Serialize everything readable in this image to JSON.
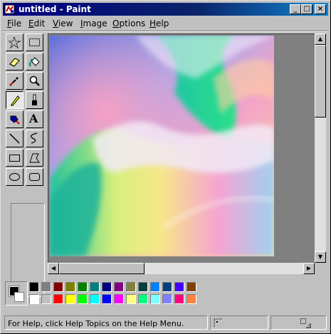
{
  "window": {
    "title": "untitled - Paint",
    "controls": {
      "minimize": "_",
      "maximize": "□",
      "close": "×"
    }
  },
  "menu": [
    {
      "underline": "F",
      "rest": "ile"
    },
    {
      "underline": "E",
      "rest": "dit"
    },
    {
      "underline": "V",
      "rest": "iew"
    },
    {
      "underline": "I",
      "rest": "mage"
    },
    {
      "underline": "O",
      "rest": "ptions"
    },
    {
      "underline": "H",
      "rest": "elp"
    }
  ],
  "tools": [
    {
      "name": "free-form-select",
      "icon": "star-select-icon"
    },
    {
      "name": "rect-select",
      "icon": "dotted-rect-icon"
    },
    {
      "name": "eraser",
      "icon": "eraser-icon"
    },
    {
      "name": "fill",
      "icon": "paint-bucket-icon"
    },
    {
      "name": "pick-color",
      "icon": "eyedropper-icon"
    },
    {
      "name": "magnifier",
      "icon": "magnifier-icon"
    },
    {
      "name": "pencil",
      "icon": "pencil-icon",
      "pressed": true
    },
    {
      "name": "brush",
      "icon": "brush-icon"
    },
    {
      "name": "airbrush",
      "icon": "airbrush-icon"
    },
    {
      "name": "text",
      "icon": "text-a-icon",
      "glyph": "A"
    },
    {
      "name": "line",
      "icon": "line-icon"
    },
    {
      "name": "curve",
      "icon": "curve-icon"
    },
    {
      "name": "rectangle",
      "icon": "rectangle-icon"
    },
    {
      "name": "polygon",
      "icon": "polygon-icon"
    },
    {
      "name": "ellipse",
      "icon": "ellipse-icon"
    },
    {
      "name": "rounded-rectangle",
      "icon": "rounded-rect-icon"
    }
  ],
  "colors": {
    "foreground": "#000000",
    "background": "#ffffff",
    "palette_top": [
      "#000000",
      "#808080",
      "#800000",
      "#808000",
      "#008000",
      "#008080",
      "#000080",
      "#800080",
      "#808040",
      "#004040",
      "#0080ff",
      "#004080",
      "#4000ff",
      "#804000"
    ],
    "palette_bottom": [
      "#ffffff",
      "#c0c0c0",
      "#ff0000",
      "#ffff00",
      "#00ff00",
      "#00ffff",
      "#0000ff",
      "#ff00ff",
      "#ffff80",
      "#00ff80",
      "#80ffff",
      "#8080ff",
      "#ff0080",
      "#ff8040"
    ]
  },
  "status": {
    "help_text": "For Help, click Help Topics on the Help Menu."
  },
  "scrollbars": {
    "vertical_position": 0.0,
    "horizontal_position": 0.0
  }
}
